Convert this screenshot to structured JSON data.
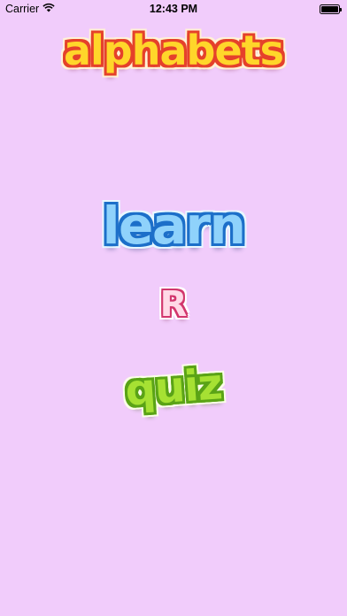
{
  "status_bar": {
    "carrier": "Carrier",
    "time": "12:43 PM",
    "icons": {
      "signal": "wifi-icon",
      "battery": "battery-icon"
    }
  },
  "screen": {
    "title": "alphabets",
    "learn_label": "learn",
    "r_label": "R",
    "quiz_label": "quiz"
  },
  "colors": {
    "background": "#f1ccfb",
    "title_fill": "#ffd62a",
    "title_outline": "#e5412b",
    "learn_fill": "#8fd2fb",
    "learn_outline": "#1c6fc9",
    "r_fill": "#ffd9e6",
    "r_outline": "#d2366d",
    "quiz_fill": "#a6e133",
    "quiz_outline": "#5aa316"
  }
}
